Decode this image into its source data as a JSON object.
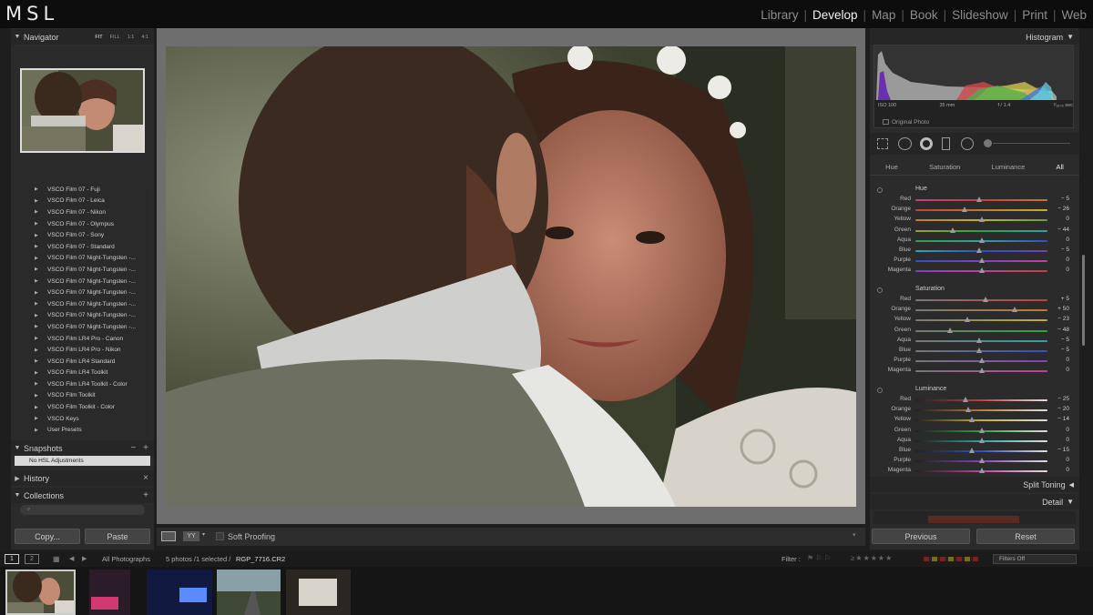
{
  "app": {
    "logo": "MSL"
  },
  "modules": [
    "Library",
    "Develop",
    "Map",
    "Book",
    "Slideshow",
    "Print",
    "Web"
  ],
  "active_module": "Develop",
  "left": {
    "navigator": {
      "title": "Navigator",
      "opts": [
        "FIT",
        "FILL",
        "1:1",
        "4:1"
      ]
    },
    "presets": [
      "VSCO Film 07 - Fuji",
      "VSCO Film 07 - Leica",
      "VSCO Film 07 - Nikon",
      "VSCO Film 07 - Olympus",
      "VSCO Film 07 - Sony",
      "VSCO Film 07 - Standard",
      "VSCO Film 07 Night-Tungsten -...",
      "VSCO Film 07 Night-Tungsten -...",
      "VSCO Film 07 Night-Tungsten -...",
      "VSCO Film 07 Night-Tungsten -...",
      "VSCO Film 07 Night-Tungsten -...",
      "VSCO Film 07 Night-Tungsten -...",
      "VSCO Film 07 Night-Tungsten -...",
      "VSCO Film LR4 Pro - Canon",
      "VSCO Film LR4 Pro - Nikon",
      "VSCO Film LR4 Standard",
      "VSCO Film LR4 Toolkit",
      "VSCO Film LR4 Toolkit - Color",
      "VSCO Film Toolkit",
      "VSCO Film Toolkit - Color",
      "VSCO Keys",
      "User Presets"
    ],
    "snapshots": {
      "title": "Snapshots",
      "minus": "−",
      "plus": "+",
      "item": "No HSL Adjustments"
    },
    "history": {
      "title": "History",
      "close": "×"
    },
    "collections": {
      "title": "Collections",
      "plus": "+"
    },
    "copy_label": "Copy...",
    "paste_label": "Paste"
  },
  "toolbar": {
    "soft_proofing": "Soft Proofing"
  },
  "right": {
    "histogram_title": "Histogram",
    "exif": {
      "iso": "ISO 100",
      "focal": "35 mm",
      "aperture": "f / 1.4",
      "shutter": "¹⁄₁₆₀₀ sec"
    },
    "original_photo": "Original Photo",
    "tabs": [
      "Hue",
      "Saturation",
      "Luminance",
      "All"
    ],
    "active_tab": "All",
    "groups": [
      {
        "title": "Hue",
        "rows": [
          {
            "label": "Red",
            "value": "− 5",
            "pos": 0.48
          },
          {
            "label": "Orange",
            "value": "− 26",
            "pos": 0.37
          },
          {
            "label": "Yellow",
            "value": "0",
            "pos": 0.5
          },
          {
            "label": "Green",
            "value": "− 44",
            "pos": 0.28
          },
          {
            "label": "Aqua",
            "value": "0",
            "pos": 0.5
          },
          {
            "label": "Blue",
            "value": "− 5",
            "pos": 0.48
          },
          {
            "label": "Purple",
            "value": "0",
            "pos": 0.5
          },
          {
            "label": "Magenta",
            "value": "0",
            "pos": 0.5
          }
        ]
      },
      {
        "title": "Saturation",
        "rows": [
          {
            "label": "Red",
            "value": "+ 5",
            "pos": 0.53
          },
          {
            "label": "Orange",
            "value": "+ 50",
            "pos": 0.75
          },
          {
            "label": "Yellow",
            "value": "− 23",
            "pos": 0.39
          },
          {
            "label": "Green",
            "value": "− 48",
            "pos": 0.26
          },
          {
            "label": "Aqua",
            "value": "− 5",
            "pos": 0.48
          },
          {
            "label": "Blue",
            "value": "− 5",
            "pos": 0.48
          },
          {
            "label": "Purple",
            "value": "0",
            "pos": 0.5
          },
          {
            "label": "Magenta",
            "value": "0",
            "pos": 0.5
          }
        ]
      },
      {
        "title": "Luminance",
        "rows": [
          {
            "label": "Red",
            "value": "− 25",
            "pos": 0.38
          },
          {
            "label": "Orange",
            "value": "− 20",
            "pos": 0.4
          },
          {
            "label": "Yellow",
            "value": "− 14",
            "pos": 0.43
          },
          {
            "label": "Green",
            "value": "0",
            "pos": 0.5
          },
          {
            "label": "Aqua",
            "value": "0",
            "pos": 0.5
          },
          {
            "label": "Blue",
            "value": "− 15",
            "pos": 0.43
          },
          {
            "label": "Purple",
            "value": "0",
            "pos": 0.5
          },
          {
            "label": "Magenta",
            "value": "0",
            "pos": 0.5
          }
        ]
      }
    ],
    "split_toning": "Split Toning",
    "detail": "Detail",
    "previous_label": "Previous",
    "reset_label": "Reset"
  },
  "filmbar": {
    "page1": "1",
    "page2": "2",
    "source": "All Photographs",
    "count": "5 photos /1 selected /",
    "filename": "RGP_7716.CR2",
    "filter_label": "Filter :",
    "filters_off": "Filters Off"
  },
  "colors": {
    "accent": "#f2f2f2",
    "panel": "#2b2b2b"
  }
}
